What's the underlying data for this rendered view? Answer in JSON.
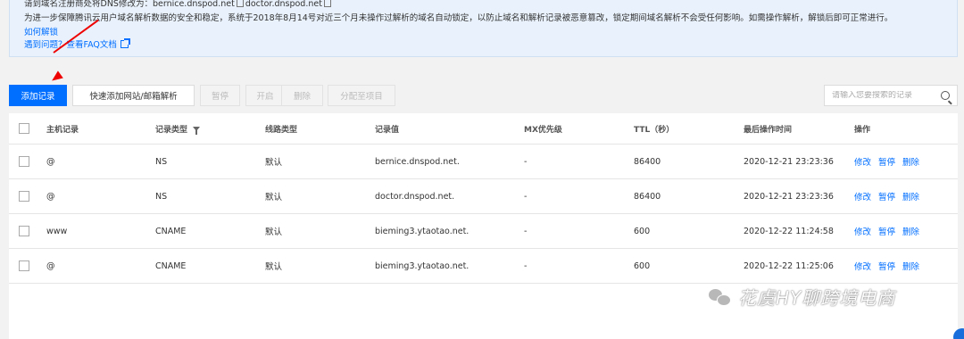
{
  "notice": {
    "line1_prefix": "请到域名注册商处将DNS修改为：bernice.dnspod.net",
    "line1_suffix": "doctor.dnspod.net",
    "line2": "为进一步保障腾讯云用户域名解析数据的安全和稳定，系统于2018年8月14号对近三个月未操作过解析的域名自动锁定，以防止域名和解析记录被恶意篡改，锁定期间域名解析不会受任何影响。如需操作解析，解锁后即可正常进行。",
    "unlock_link": "如何解锁",
    "faq_link": "遇到问题？查看FAQ文档"
  },
  "toolbar": {
    "add_record": "添加记录",
    "quick_add": "快速添加网站/邮箱解析",
    "pause": "暂停",
    "enable": "开启",
    "delete": "删除",
    "assign_project": "分配至项目",
    "search_placeholder": "请输入您要搜索的记录"
  },
  "table": {
    "headers": {
      "host": "主机记录",
      "type": "记录类型",
      "line": "线路类型",
      "value": "记录值",
      "mx": "MX优先级",
      "ttl": "TTL（秒）",
      "last_op": "最后操作时间",
      "ops": "操作"
    },
    "rows": [
      {
        "host": "@",
        "type": "NS",
        "line": "默认",
        "value": "bernice.dnspod.net.",
        "mx": "-",
        "ttl": "86400",
        "last_op": "2020-12-21 23:23:36",
        "edit": "修改",
        "pause": "暂停",
        "delete": "删除"
      },
      {
        "host": "@",
        "type": "NS",
        "line": "默认",
        "value": "doctor.dnspod.net.",
        "mx": "-",
        "ttl": "86400",
        "last_op": "2020-12-21 23:23:36",
        "edit": "修改",
        "pause": "暂停",
        "delete": "删除"
      },
      {
        "host": "www",
        "type": "CNAME",
        "line": "默认",
        "value": "bieming3.ytaotao.net.",
        "mx": "-",
        "ttl": "600",
        "last_op": "2020-12-22 11:24:58",
        "edit": "修改",
        "pause": "暂停",
        "delete": "删除"
      },
      {
        "host": "@",
        "type": "CNAME",
        "line": "默认",
        "value": "bieming3.ytaotao.net.",
        "mx": "-",
        "ttl": "600",
        "last_op": "2020-12-22 11:25:06",
        "edit": "修改",
        "pause": "暂停",
        "delete": "删除"
      }
    ]
  },
  "watermark": {
    "text": "花虞HY聊跨境电商",
    "icon": "wechat-icon"
  },
  "colors": {
    "accent": "#006eff",
    "arrow": "#ee0000",
    "notice_bg": "#e9f2fc"
  }
}
